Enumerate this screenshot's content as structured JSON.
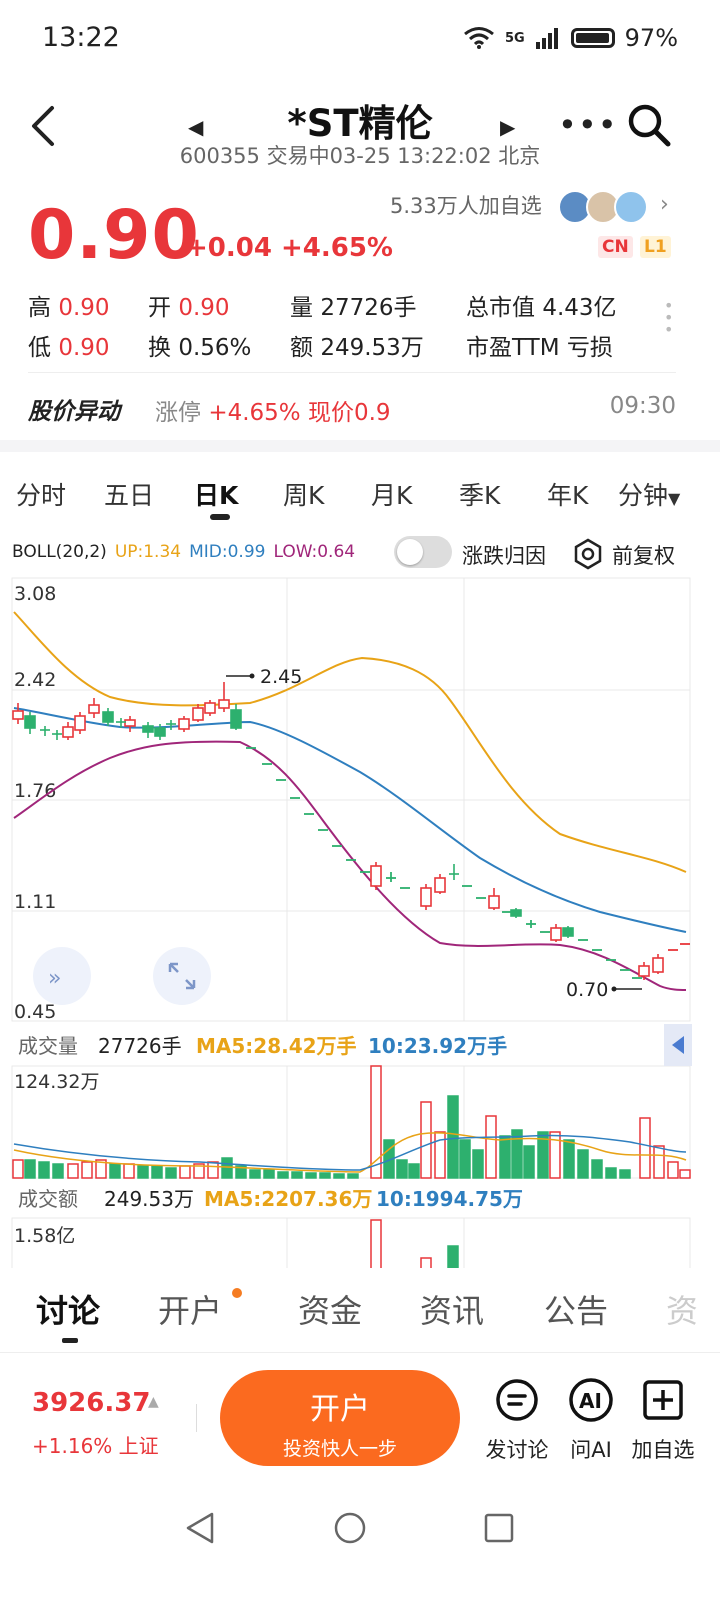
{
  "status_bar": {
    "time": "13:22",
    "network": "5G",
    "battery": "97%"
  },
  "header": {
    "title": "*ST精伦",
    "code": "600355",
    "subtitle": "600355 交易中03-25 13:22:02 北京"
  },
  "quote": {
    "price": "0.90",
    "change": "+0.04 +4.65%",
    "followers": "5.33万人加自选",
    "badges": [
      "CN",
      "L1"
    ]
  },
  "stats": {
    "high_label": "高",
    "high": "0.90",
    "open_label": "开",
    "open": "0.90",
    "vol_label": "量",
    "vol": "27726手",
    "mcap_label": "总市值",
    "mcap": "4.43亿",
    "low_label": "低",
    "low": "0.90",
    "turn_label": "换",
    "turn": "0.56%",
    "amt_label": "额",
    "amt": "249.53万",
    "pe_label": "市盈TTM",
    "pe": "亏损"
  },
  "alert": {
    "title": "股价异动",
    "type": "涨停",
    "pct": "+4.65%",
    "now": "现价0.9",
    "time": "09:30"
  },
  "period_tabs": [
    "分时",
    "五日",
    "日K",
    "周K",
    "月K",
    "季K",
    "年K",
    "分钟"
  ],
  "boll": {
    "label": "BOLL(20,2)",
    "up": "UP:1.34",
    "mid": "MID:0.99",
    "low": "LOW:0.64",
    "attr_label": "涨跌归因",
    "fq_label": "前复权"
  },
  "chart": {
    "y_ticks": [
      "3.08",
      "2.42",
      "1.76",
      "1.11",
      "0.45"
    ],
    "max_label": "2.45",
    "min_label": "0.70"
  },
  "volume": {
    "title": "成交量",
    "value": "27726手",
    "ma5": "MA5:28.42万手",
    "ma10": "10:23.92万手",
    "max_tick": "124.32万"
  },
  "amount": {
    "title": "成交额",
    "value": "249.53万",
    "ma5": "MA5:2207.36万",
    "ma10": "10:1994.75万",
    "max_tick": "1.58亿"
  },
  "bottom_tabs": [
    "讨论",
    "开户",
    "资金",
    "资讯",
    "公告",
    "资"
  ],
  "index": {
    "value": "3926.37",
    "change": "+1.16% 上证"
  },
  "open_account": {
    "line1": "开户",
    "line2": "投资快人一步"
  },
  "actions": {
    "discuss": "发讨论",
    "ai": "问AI",
    "add": "加自选",
    "ai_icon_text": "AI"
  },
  "colors": {
    "up": "#e8363a",
    "down": "#2db06e",
    "boll_up": "#e8a317",
    "boll_mid": "#2f7fbf",
    "boll_low": "#a0267a",
    "accent": "#fb6a1f"
  }
}
